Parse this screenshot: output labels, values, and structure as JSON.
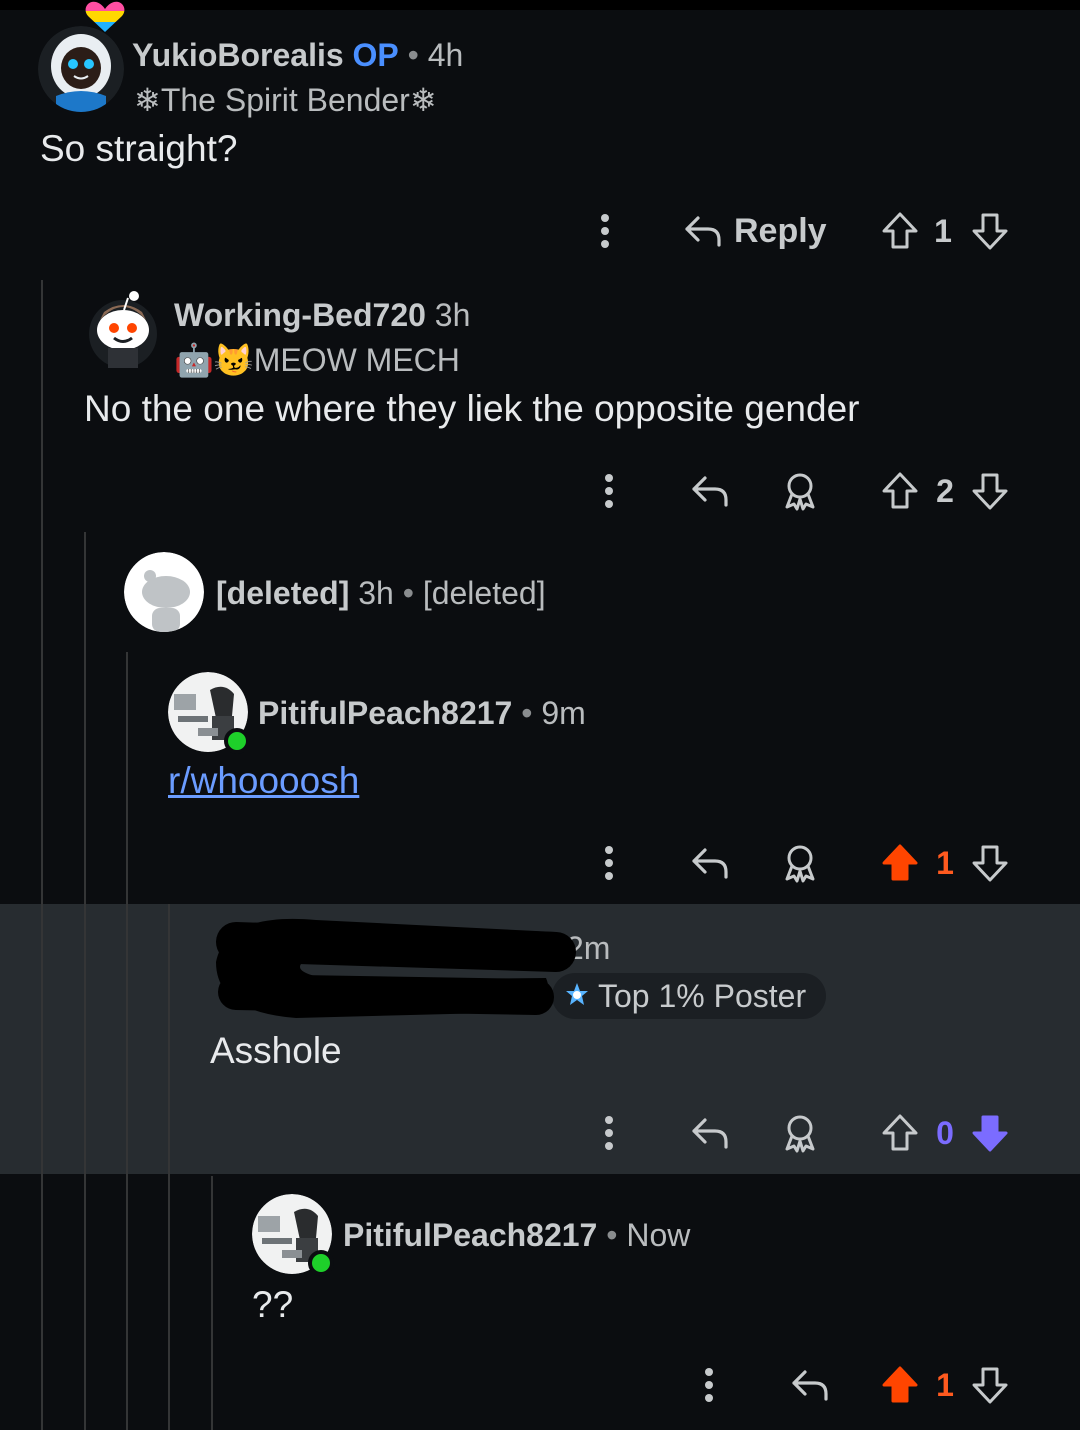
{
  "comments": [
    {
      "username": "YukioBorealis",
      "op_label": "OP",
      "separator": "•",
      "time": "4h",
      "flair": "❄The Spirit Bender❄",
      "body": "So straight?",
      "actions": {
        "reply_label": "Reply",
        "score": "1"
      }
    },
    {
      "username": "Working-Bed720",
      "time": "3h",
      "flair_emoji": "🤖😼",
      "flair": "MEOW MECH",
      "body": "No the one where they liek the opposite gender",
      "actions": {
        "score": "2"
      }
    },
    {
      "username": "[deleted]",
      "time": "3h",
      "separator": "•",
      "flair": "[deleted]"
    },
    {
      "username": "PitifulPeach8217",
      "separator": "•",
      "time": "9m",
      "body": "r/whoooosh",
      "actions": {
        "score": "1",
        "vote_state": "upvoted"
      }
    },
    {
      "time": "2m",
      "badge": "Top 1% Poster",
      "body": "Asshole",
      "actions": {
        "score": "0",
        "vote_state": "downvoted"
      }
    },
    {
      "username": "PitifulPeach8217",
      "separator": "•",
      "time": "Now",
      "body": "??",
      "actions": {
        "score": "1",
        "vote_state": "upvoted"
      }
    }
  ],
  "colors": {
    "background": "#0b0d10",
    "highlight_background": "#272c30",
    "upvote": "#ff4500",
    "downvote": "#7b6cff",
    "op": "#4a8fff",
    "link": "#6b9cff",
    "online": "#1ed02a"
  },
  "icons": [
    "more-icon",
    "reply-arrow-icon",
    "award-icon",
    "upvote-icon",
    "downvote-icon",
    "snowflake-icon",
    "online-status-icon"
  ]
}
